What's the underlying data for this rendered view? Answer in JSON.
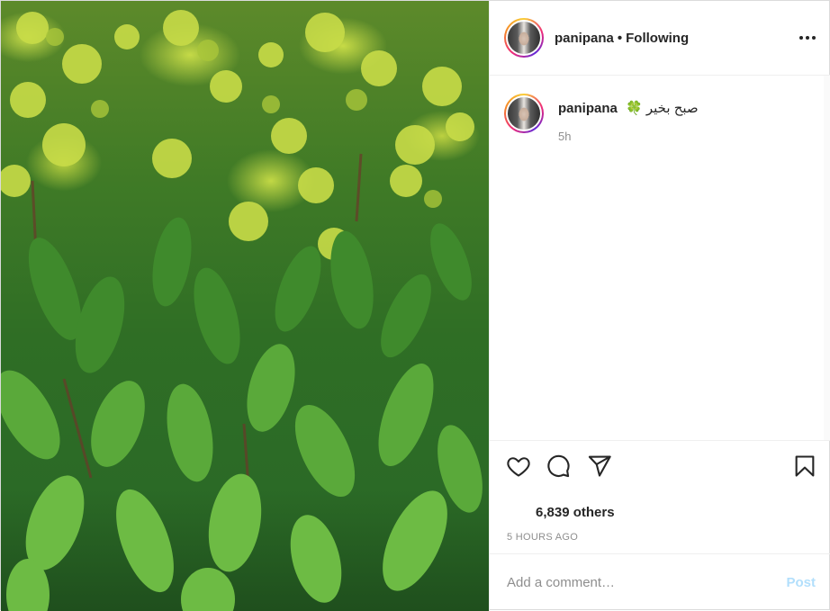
{
  "post": {
    "username": "panipana",
    "separator": "•",
    "follow_status": "Following",
    "more_icon": "more-horizontal-icon",
    "caption": {
      "text": "صبح بخیر 🍀",
      "time": "5h"
    },
    "actions": {
      "like_icon": "heart-icon",
      "comment_icon": "comment-icon",
      "share_icon": "paper-plane-icon",
      "save_icon": "bookmark-icon"
    },
    "likes_text": "6,839 others",
    "date": "5 HOURS AGO",
    "comment": {
      "placeholder": "Add a comment…",
      "value": "",
      "post_label": "Post"
    }
  },
  "colors": {
    "text": "#262626",
    "muted": "#8e8e8e",
    "post_disabled": "#b2dffc",
    "border": "#efefef"
  }
}
